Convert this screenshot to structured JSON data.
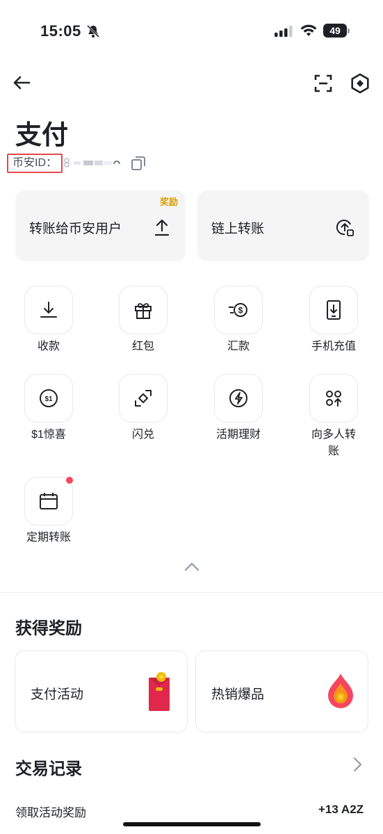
{
  "status_bar": {
    "time": "15:05",
    "battery": "49"
  },
  "header": {
    "title": "支付",
    "uid_label": "币安ID："
  },
  "transfer": {
    "to_user_label": "转账给币安用户",
    "reward_tag": "奖励",
    "onchain_label": "链上转账"
  },
  "grid": [
    {
      "label": "收款",
      "icon": "download-icon"
    },
    {
      "label": "红包",
      "icon": "gift-icon"
    },
    {
      "label": "汇款",
      "icon": "remittance-icon"
    },
    {
      "label": "手机充值",
      "icon": "mobile-topup-icon"
    },
    {
      "label": "$1惊喜",
      "icon": "dollar-coin-icon"
    },
    {
      "label": "闪兑",
      "icon": "convert-icon"
    },
    {
      "label": "活期理财",
      "icon": "lightning-icon"
    },
    {
      "label": "向多人转账",
      "icon": "multi-transfer-icon"
    },
    {
      "label": "定期转账",
      "icon": "calendar-icon"
    }
  ],
  "rewards": {
    "title": "获得奖励",
    "items": [
      {
        "label": "支付活动",
        "icon": "red-envelope-icon"
      },
      {
        "label": "热销爆品",
        "icon": "fire-icon"
      }
    ]
  },
  "transactions": {
    "title": "交易记录",
    "items": [
      {
        "label": "领取活动奖励",
        "amount": "+13 A2Z"
      }
    ]
  },
  "colors": {
    "accent_yellow": "#F0B90B",
    "reward_text": "#D89F00",
    "highlight_red": "#E0484D",
    "dot_red": "#F6465D"
  }
}
